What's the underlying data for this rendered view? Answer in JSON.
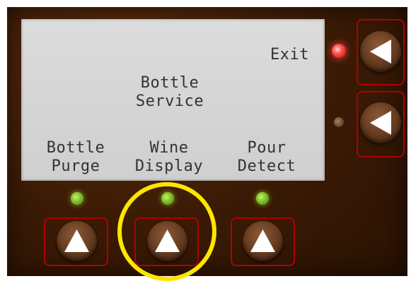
{
  "lcd": {
    "exit_label": "Exit",
    "title": "Bottle\nService",
    "softkeys": [
      {
        "label": "Bottle\nPurge"
      },
      {
        "label": "Wine\nDisplay"
      },
      {
        "label": "Pour\nDetect"
      }
    ]
  },
  "icons": {
    "side_buttons": [
      "left-arrow-icon",
      "left-arrow-icon"
    ],
    "bottom_buttons": [
      "up-arrow-icon",
      "up-arrow-icon",
      "up-arrow-icon"
    ]
  },
  "colors": {
    "panel": "#3a1a04",
    "lcd": "#d7d7d7",
    "frame": "#b00000",
    "highlight": "#ffe600",
    "led_on": "#7fbf2a",
    "led_exit": "#ff4a4a"
  }
}
